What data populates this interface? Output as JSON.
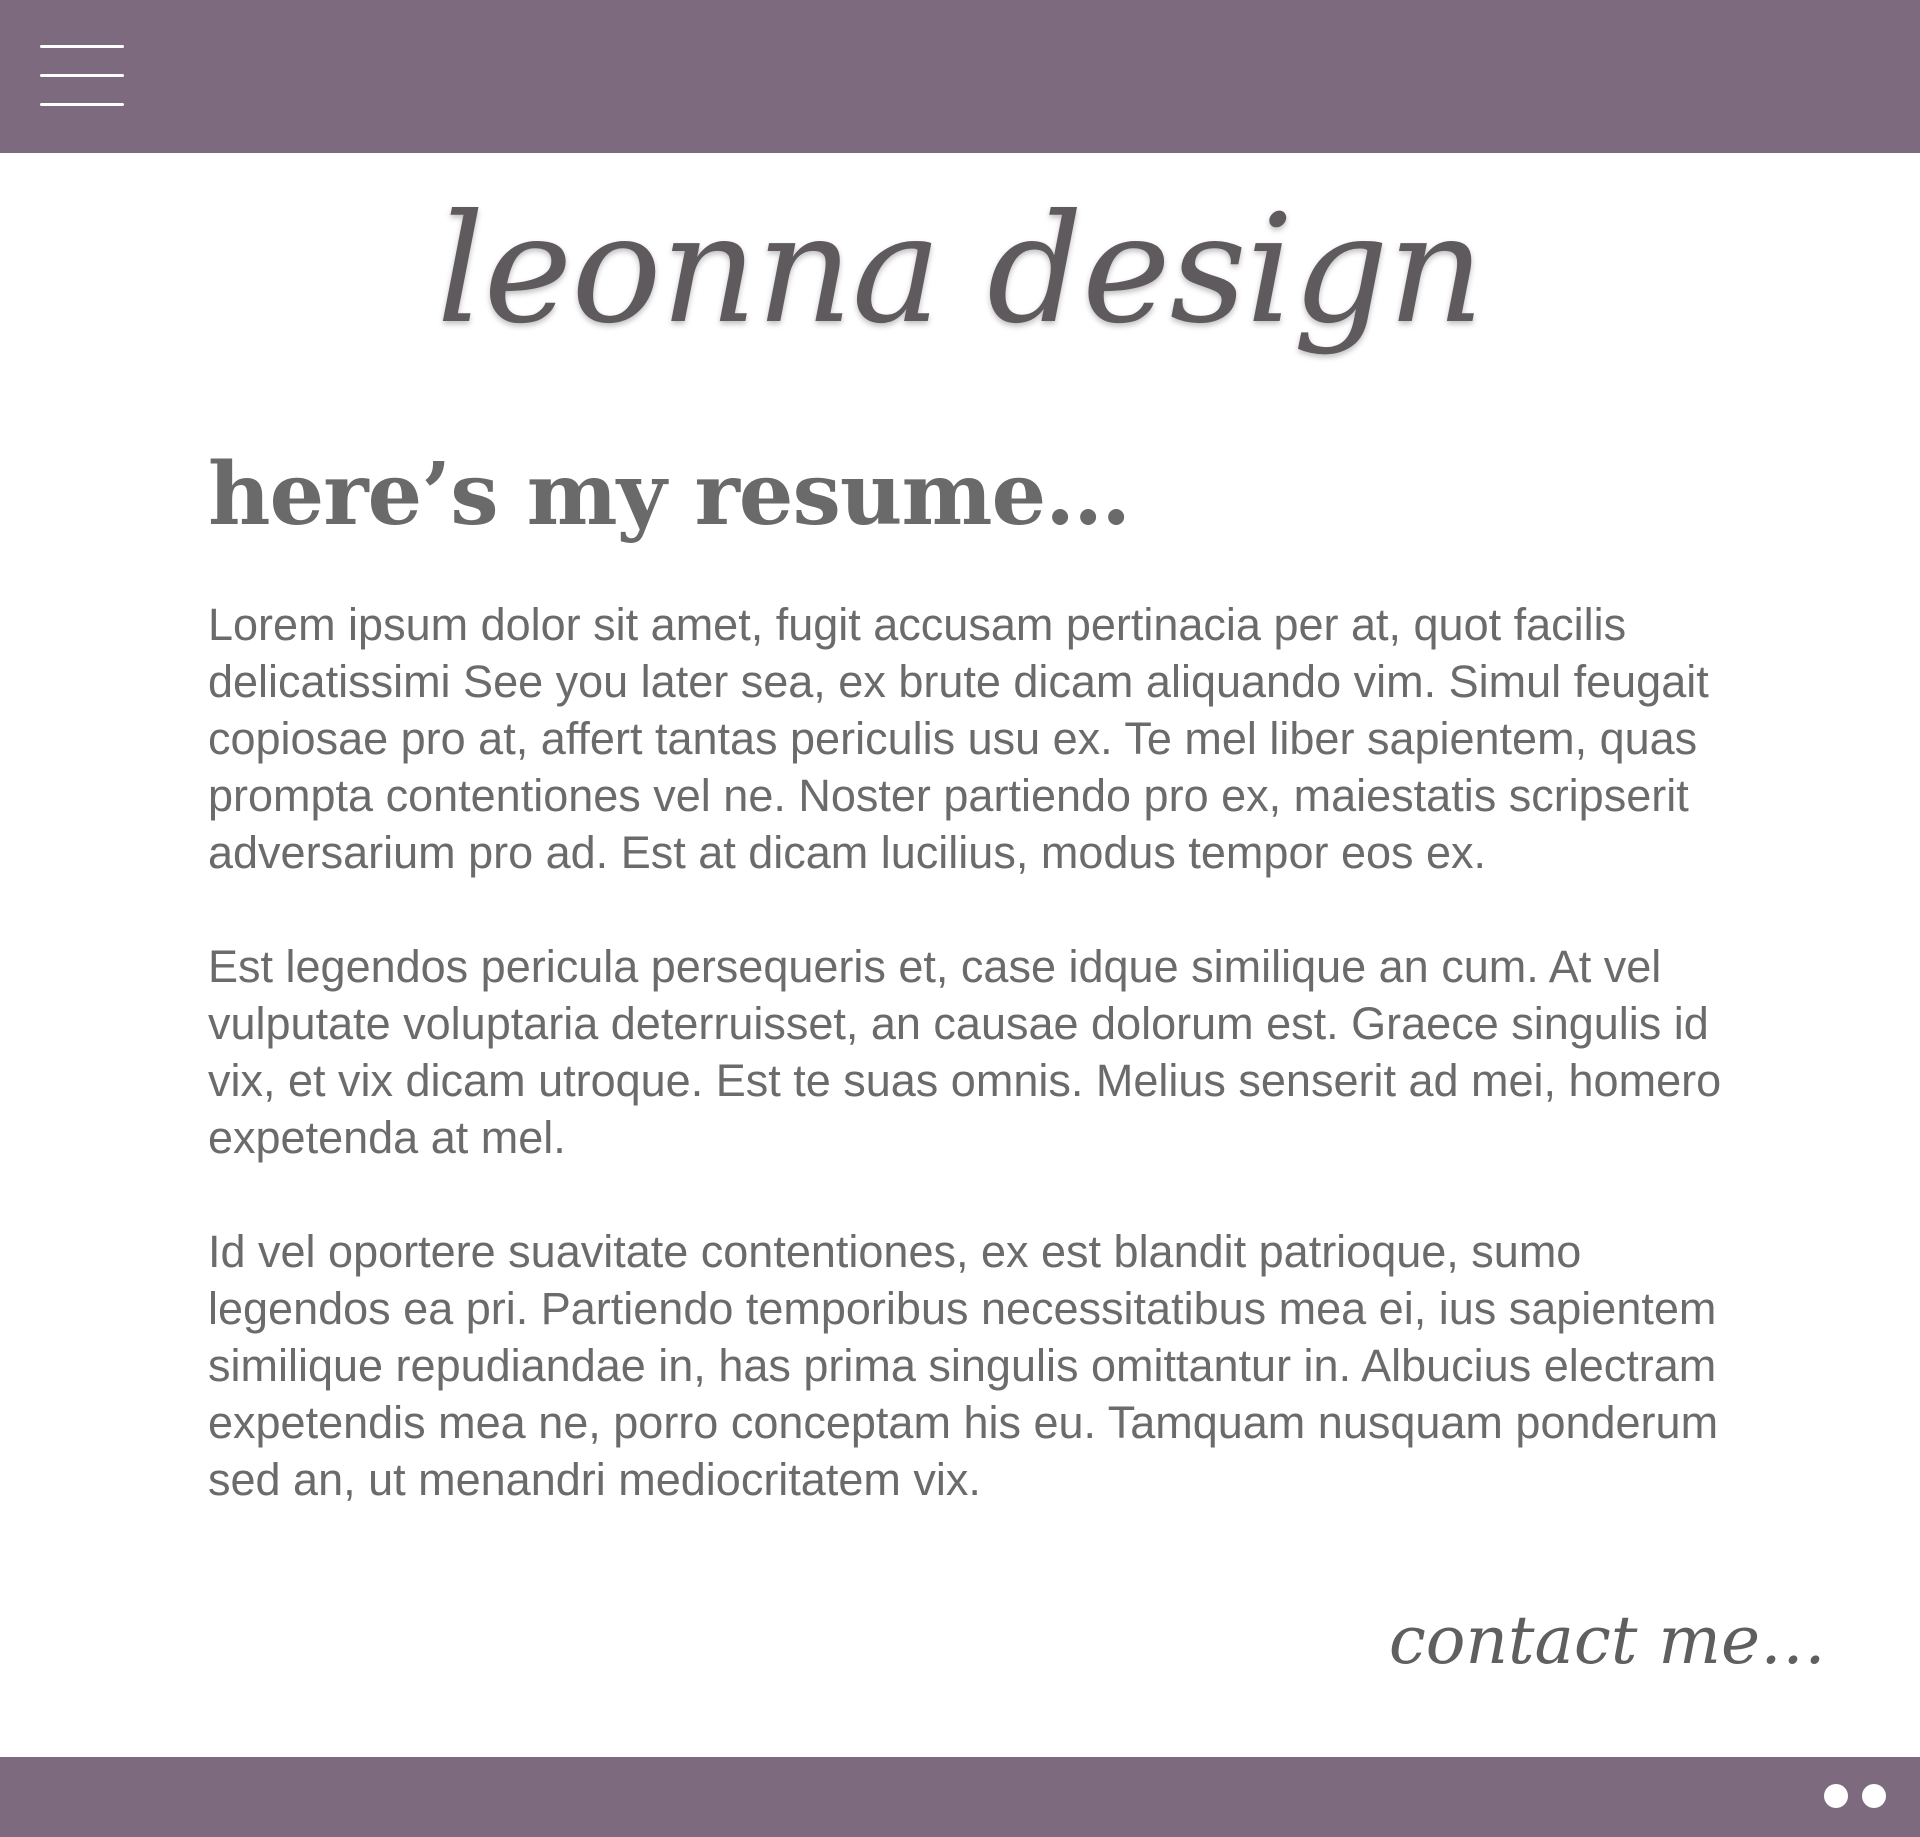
{
  "header": {
    "menu_icon": "hamburger-menu-icon",
    "background_color": "#7d6a7e"
  },
  "logo": {
    "text": "leonna design"
  },
  "main": {
    "title": "here’s my resume…",
    "paragraphs": [
      "Lorem ipsum dolor sit amet, fugit accusam pertinacia per at, quot facilis delicatissimi See you later sea, ex brute dicam aliquando vim. Simul feugait copiosae pro at, affert tantas periculis usu ex. Te mel liber sapientem, quas prompta contentiones vel ne. Noster partiendo pro ex, maiestatis scripserit adversarium pro ad. Est at dicam lucilius, modus tempor eos ex.",
      "Est legendos pericula persequeris et, case idque similique an cum. At vel vulputate voluptaria deterruisset, an causae dolorum est. Graece singulis id vix, et vix dicam utroque. Est te suas omnis. Melius senserit ad mei, homero expetenda at mel.",
      "Id vel oportere suavitate contentiones, ex est blandit patrioque, sumo legendos ea pri. Partiendo temporibus necessitatibus mea ei, ius sapientem similique repudiandae in, has prima singulis omittantur in. Albucius electram expetendis mea ne, porro conceptam his eu. Tamquam nusquam ponderum sed an, ut menandri mediocritatem vix."
    ],
    "contact_label": "contact me…"
  },
  "footer": {
    "background_color": "#7d6a7e",
    "dots": [
      "dot-1",
      "dot-2"
    ]
  }
}
